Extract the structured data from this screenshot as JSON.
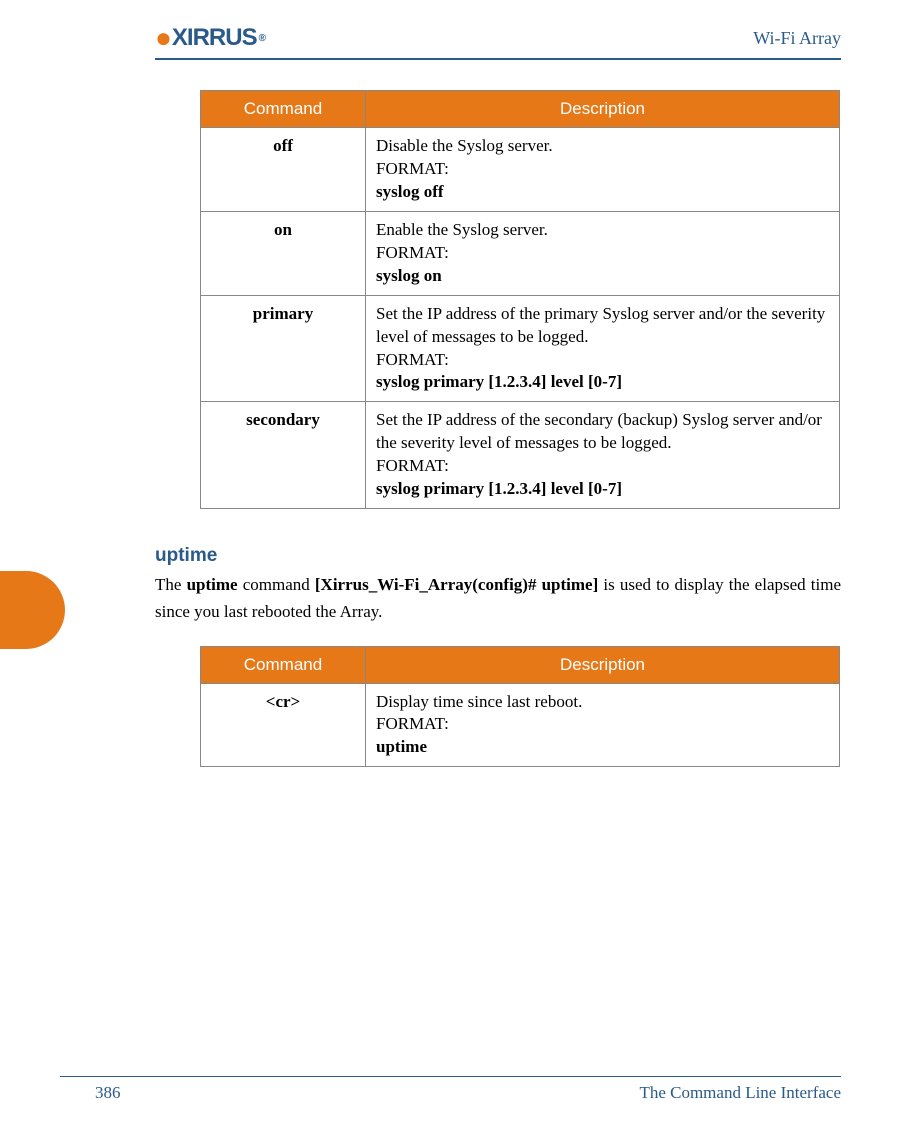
{
  "header": {
    "brand": "XIRRUS",
    "title": "Wi-Fi Array"
  },
  "table1": {
    "headers": {
      "cmd": "Command",
      "desc": "Description"
    },
    "rows": [
      {
        "cmd": "off",
        "lines": [
          {
            "text": "Disable the Syslog server.",
            "bold": false
          },
          {
            "text": "FORMAT:",
            "bold": false
          },
          {
            "text": "syslog off",
            "bold": true
          }
        ]
      },
      {
        "cmd": "on",
        "lines": [
          {
            "text": "Enable the Syslog server.",
            "bold": false
          },
          {
            "text": "FORMAT:",
            "bold": false
          },
          {
            "text": "syslog on",
            "bold": true
          }
        ]
      },
      {
        "cmd": "primary",
        "lines": [
          {
            "text": "Set the IP address of the primary Syslog server and/or the severity level of messages to be logged.",
            "bold": false
          },
          {
            "text": "FORMAT:",
            "bold": false
          },
          {
            "text": "syslog primary [1.2.3.4] level [0-7]",
            "bold": true
          }
        ]
      },
      {
        "cmd": "secondary",
        "lines": [
          {
            "text": "Set the IP address of the secondary (backup) Syslog server and/or the severity level of messages to be logged.",
            "bold": false
          },
          {
            "text": "FORMAT:",
            "bold": false
          },
          {
            "text": "syslog primary [1.2.3.4] level [0-7]",
            "bold": true
          }
        ]
      }
    ]
  },
  "section": {
    "heading": "uptime",
    "para_parts": [
      {
        "text": "The ",
        "bold": false
      },
      {
        "text": "uptime",
        "bold": true
      },
      {
        "text": " command ",
        "bold": false
      },
      {
        "text": "[Xirrus_Wi-Fi_Array(config)# uptime]",
        "bold": true
      },
      {
        "text": " is used to display the elapsed time since you last rebooted the Array.",
        "bold": false
      }
    ]
  },
  "table2": {
    "headers": {
      "cmd": "Command",
      "desc": "Description"
    },
    "rows": [
      {
        "cmd": "<cr>",
        "lines": [
          {
            "text": "Display time since last reboot.",
            "bold": false
          },
          {
            "text": "FORMAT:",
            "bold": false
          },
          {
            "text": "uptime",
            "bold": true
          }
        ]
      }
    ]
  },
  "footer": {
    "page": "386",
    "chapter": "The Command Line Interface"
  }
}
